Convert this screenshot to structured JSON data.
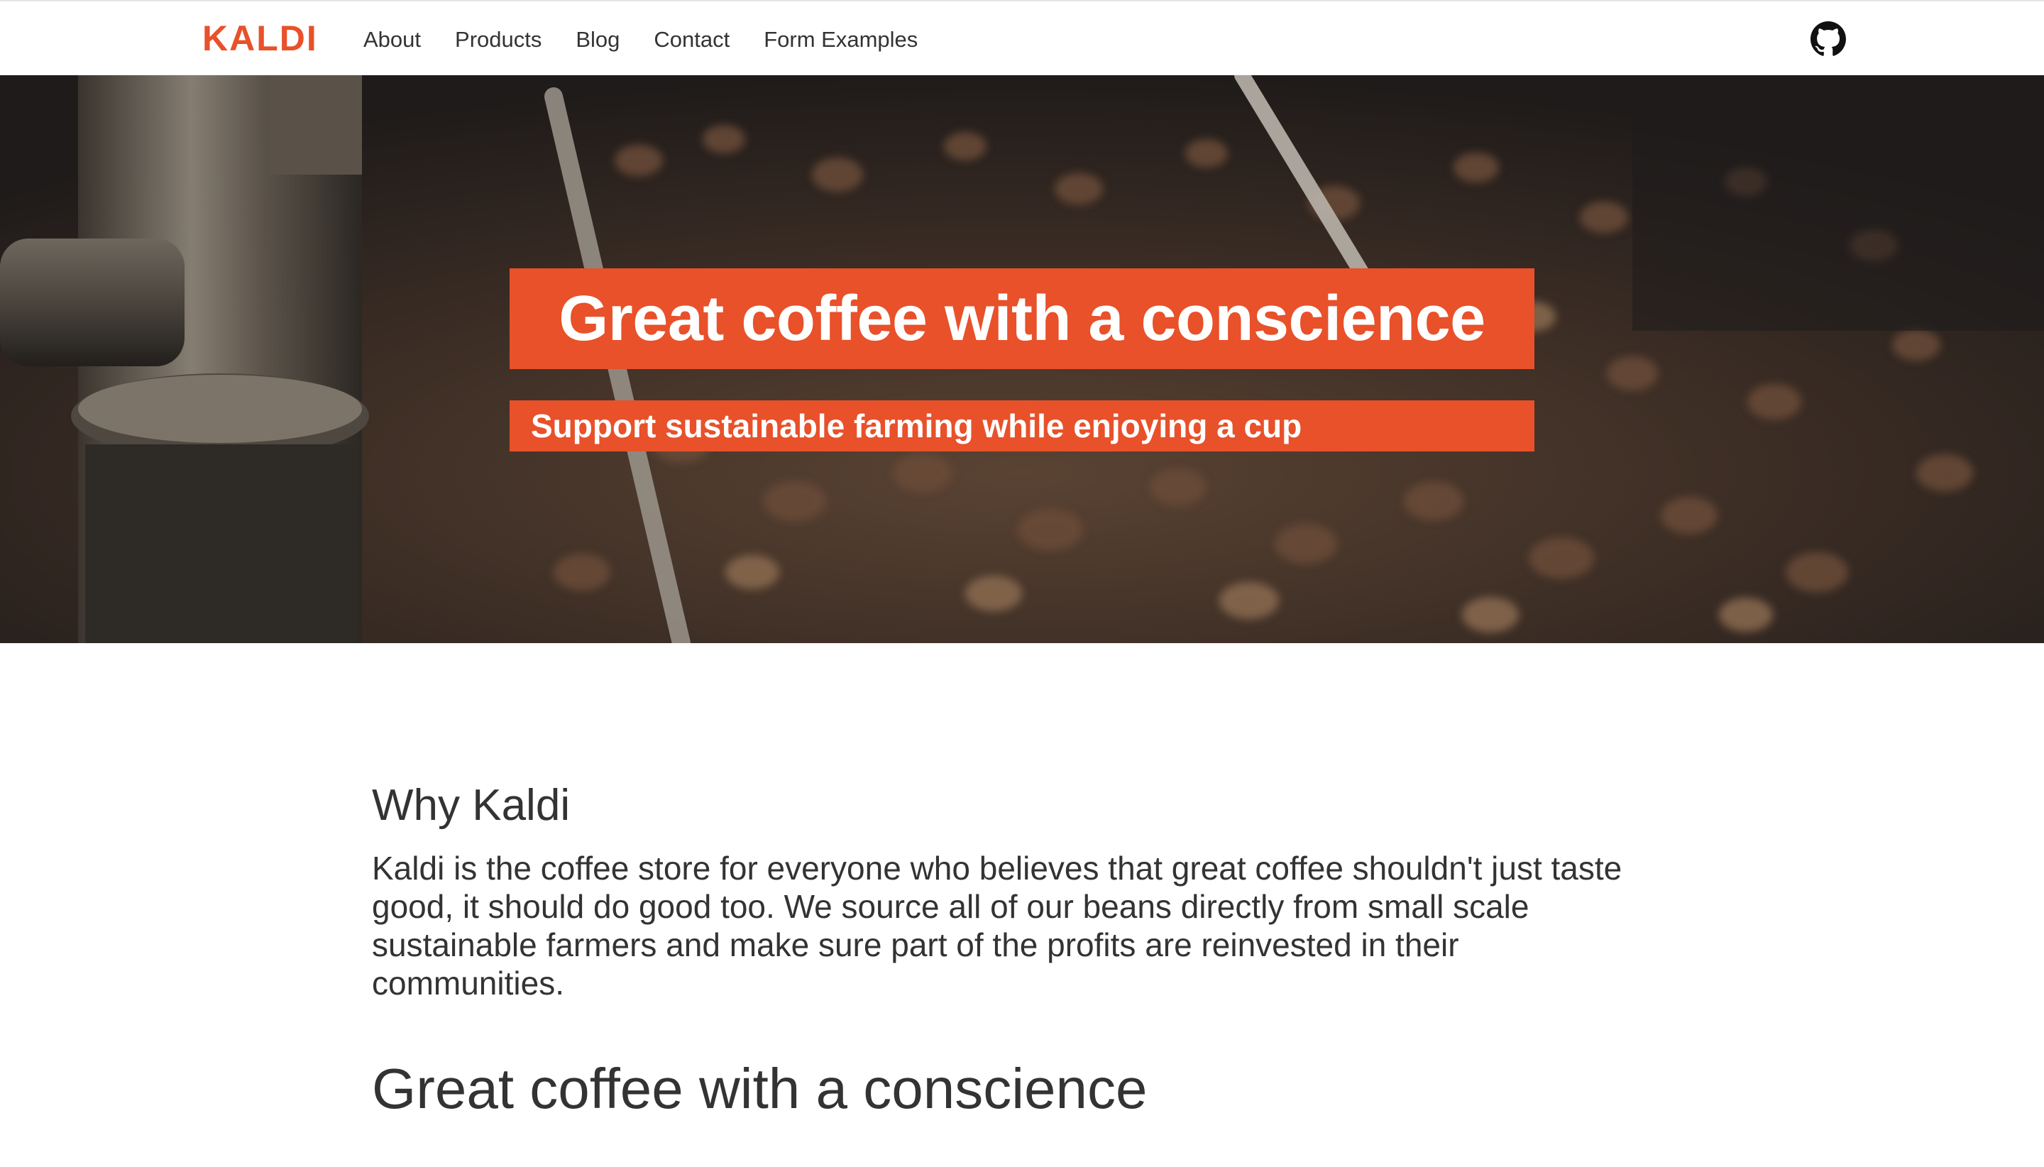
{
  "header": {
    "logo": "KALDI",
    "nav": [
      "About",
      "Products",
      "Blog",
      "Contact",
      "Form Examples"
    ],
    "github_icon": "github-icon"
  },
  "hero": {
    "title": "Great coffee with a conscience",
    "subtitle": "Support sustainable farming while enjoying a cup",
    "image": "coffee-roaster-beans-photo"
  },
  "main": {
    "why_heading": "Why Kaldi",
    "why_text": "Kaldi is the coffee store for everyone who believes that great coffee shouldn't just taste good, it should do good too. We source all of our beans directly from small scale sustainable farmers and make sure part of the profits are reinvested in their communities.",
    "section_heading": "Great coffee with a conscience"
  },
  "colors": {
    "accent": "#e8512a",
    "text": "#333333"
  }
}
